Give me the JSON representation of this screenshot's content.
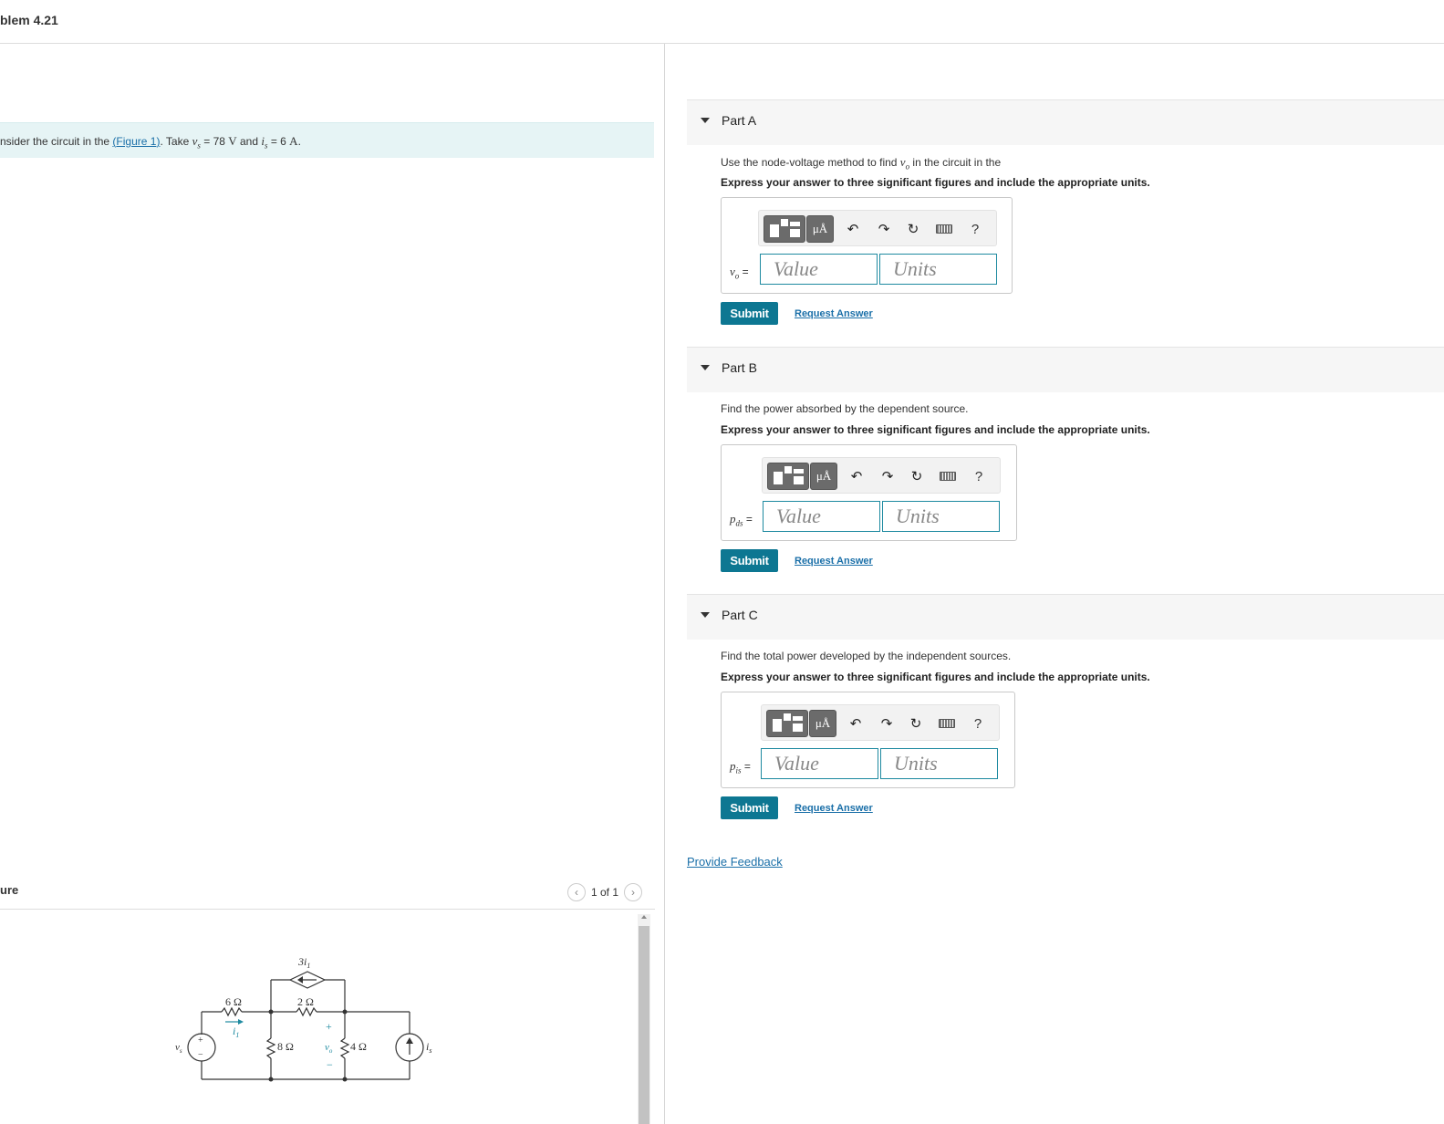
{
  "problem": {
    "title": "blem 4.21"
  },
  "intro": {
    "prefix": "nsider the circuit in the",
    "open_paren": "(",
    "figure_link": "Figure 1",
    "close_paren": ")",
    "take": ". Take",
    "vs_sym": "v",
    "vs_sub": "s",
    "vs_eq": " = 78 ",
    "vs_unit": "V",
    "and": " and ",
    "is_sym": "i",
    "is_sub": "s",
    "is_eq": " = 6 ",
    "is_unit": "A",
    "period": "."
  },
  "figure": {
    "label": "ure",
    "pager_text": "1 of 1",
    "prev_icon": "chevron-left-icon",
    "next_icon": "chevron-right-icon",
    "circuit": {
      "dep_source": "3i",
      "dep_source_sub": "1",
      "r1": "6 Ω",
      "r2": "2 Ω",
      "r3": "8 Ω",
      "r4": "4 Ω",
      "i1": "i",
      "i1_sub": "1",
      "vs": "v",
      "vs_sub": "s",
      "vo": "v",
      "vo_sub": "o",
      "is": "i",
      "is_sub": "s",
      "plus": "+",
      "minus": "−"
    }
  },
  "toolbar": {
    "mu_label": "μÅ",
    "undo_icon": "undo-icon",
    "redo_icon": "redo-icon",
    "reset_icon": "reset-icon",
    "keyboard_icon": "keyboard-icon",
    "help_label": "?"
  },
  "parts": [
    {
      "title": "Part A",
      "question_pre": "Use the node-voltage method to find ",
      "question_sym": "v",
      "question_sub": "o",
      "question_post": " in the circuit in the",
      "instruction": "Express your answer to three significant figures and include the appropriate units.",
      "var_sym": "v",
      "var_sub": "o",
      "var_eq": " =",
      "value_placeholder": "Value",
      "units_placeholder": "Units",
      "submit": "Submit",
      "request": "Request Answer"
    },
    {
      "title": "Part B",
      "question_pre": "Find the power absorbed by the dependent source.",
      "instruction": "Express your answer to three significant figures and include the appropriate units.",
      "var_sym": "p",
      "var_sub": "ds",
      "var_eq": " =",
      "value_placeholder": "Value",
      "units_placeholder": "Units",
      "submit": "Submit",
      "request": "Request Answer"
    },
    {
      "title": "Part C",
      "question_pre": "Find the total power developed by the independent sources.",
      "instruction": "Express your answer to three significant figures and include the appropriate units.",
      "var_sym": "p",
      "var_sub": "is",
      "var_eq": " =",
      "value_placeholder": "Value",
      "units_placeholder": "Units",
      "submit": "Submit",
      "request": "Request Answer"
    }
  ],
  "feedback": "Provide Feedback"
}
